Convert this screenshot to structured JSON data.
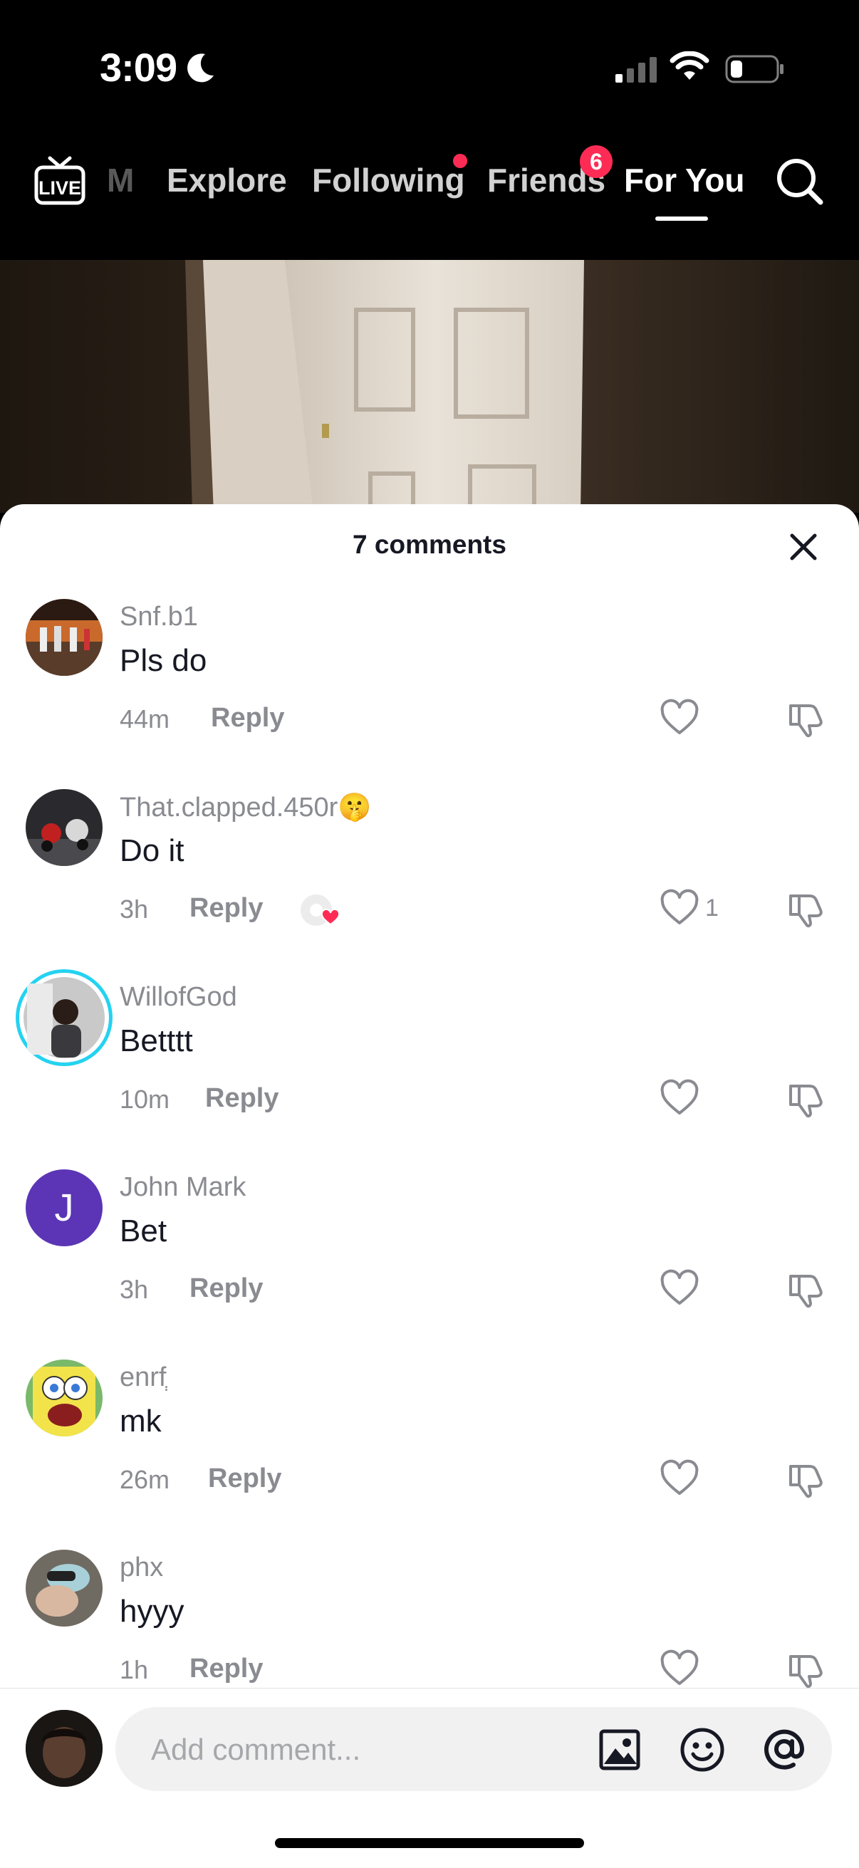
{
  "status_bar": {
    "time": "3:09"
  },
  "topnav": {
    "tabs": [
      {
        "label": "M"
      },
      {
        "label": "Explore"
      },
      {
        "label": "Following"
      },
      {
        "label": "Friends",
        "badge": "6"
      },
      {
        "label": "For You"
      }
    ],
    "live_label": "LIVE"
  },
  "comments_sheet": {
    "title": "7 comments",
    "comments": [
      {
        "username": "Snf.b1",
        "text": "Pls do",
        "time": "44m",
        "reply_label": "Reply",
        "likes": ""
      },
      {
        "username": "That.clapped.450r🤫",
        "text": "Do it",
        "time": "3h",
        "reply_label": "Reply",
        "likes": "1"
      },
      {
        "username": "WillofGod",
        "text": "Betttt",
        "time": "10m",
        "reply_label": "Reply",
        "likes": ""
      },
      {
        "username": "John Mark",
        "text": "Bet",
        "time": "3h",
        "reply_label": "Reply",
        "likes": "",
        "avatar_letter": "J"
      },
      {
        "username": "enrfְ",
        "text": "mk",
        "time": "26m",
        "reply_label": "Reply",
        "likes": ""
      },
      {
        "username": "phx",
        "text": "hyyy",
        "time": "1h",
        "reply_label": "Reply",
        "likes": ""
      }
    ]
  },
  "input_bar": {
    "placeholder": "Add comment..."
  },
  "colors": {
    "accent": "#fe2c55",
    "muted_text": "#8a8b91",
    "story_ring": "#25d2f0",
    "avatar_purple": "#5b35b5"
  },
  "icons": [
    "live-icon",
    "search-icon",
    "close-icon",
    "heart-icon",
    "dislike-icon",
    "image-icon",
    "emoji-icon",
    "at-icon"
  ]
}
